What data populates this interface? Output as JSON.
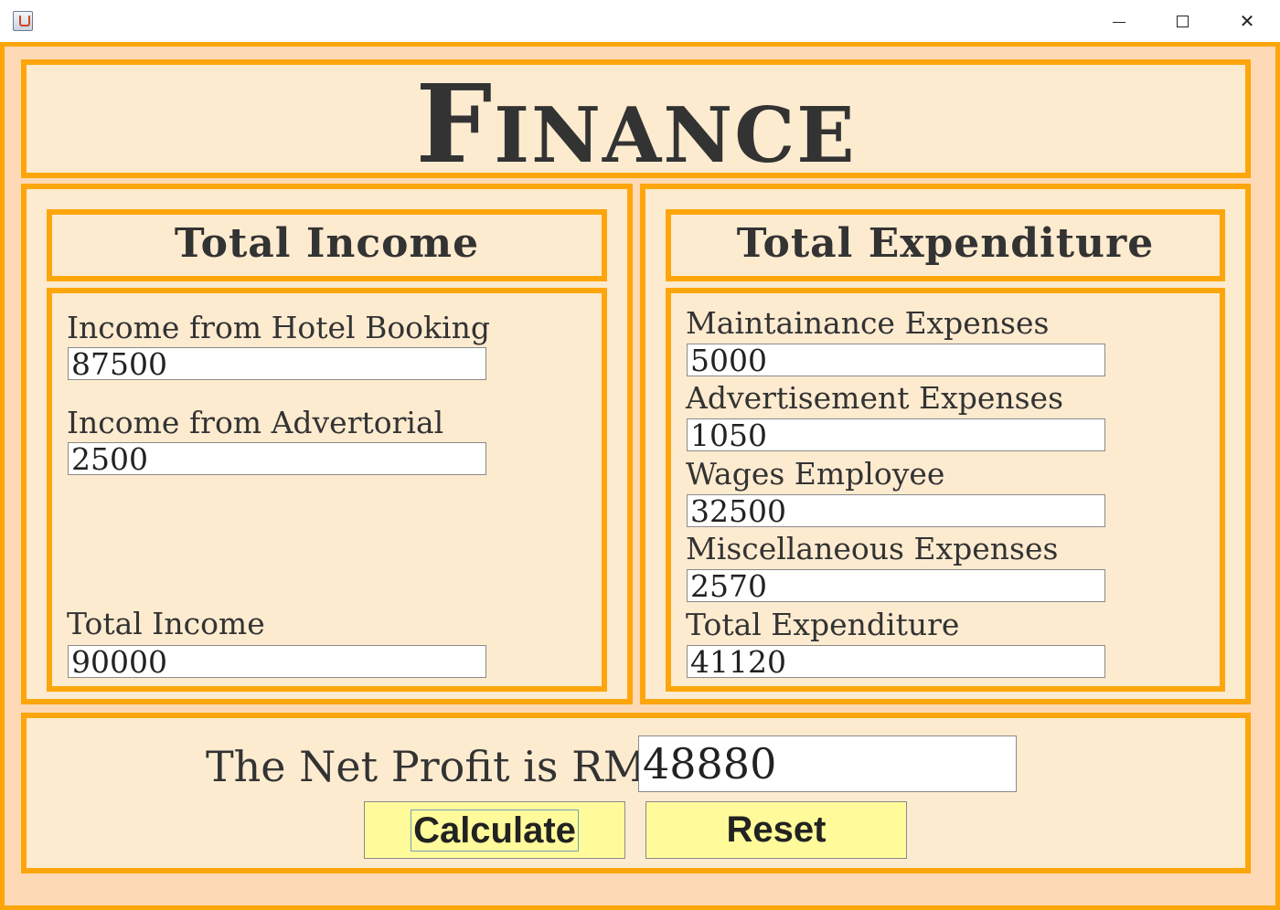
{
  "window": {
    "minimize_glyph": "—",
    "close_glyph": "✕"
  },
  "header": {
    "title": "Finance"
  },
  "income": {
    "heading": "Total Income",
    "fields": [
      {
        "label": "Income from Hotel Booking",
        "value": "87500"
      },
      {
        "label": "Income from Advertorial",
        "value": "2500"
      },
      {
        "label": "Total Income",
        "value": "90000"
      }
    ]
  },
  "expenditure": {
    "heading": "Total Expenditure",
    "fields": [
      {
        "label": "Maintainance Expenses",
        "value": "5000"
      },
      {
        "label": "Advertisement Expenses",
        "value": "1050"
      },
      {
        "label": "Wages Employee",
        "value": "32500"
      },
      {
        "label": "Miscellaneous Expenses",
        "value": "2570"
      },
      {
        "label": "Total Expenditure",
        "value": "41120"
      }
    ]
  },
  "net": {
    "label": "The Net Profit is RM",
    "value": "48880"
  },
  "buttons": {
    "calculate": "Calculate",
    "reset": "Reset"
  },
  "colors": {
    "frame_orange": "#fda60c",
    "panel_fill": "#fdebd0",
    "outer_fill": "#fdd9b5",
    "button_fill": "#fffb9b"
  },
  "icons": {
    "app": "java-app-icon",
    "minimize": "minimize-icon",
    "maximize": "maximize-icon",
    "close": "close-icon"
  }
}
